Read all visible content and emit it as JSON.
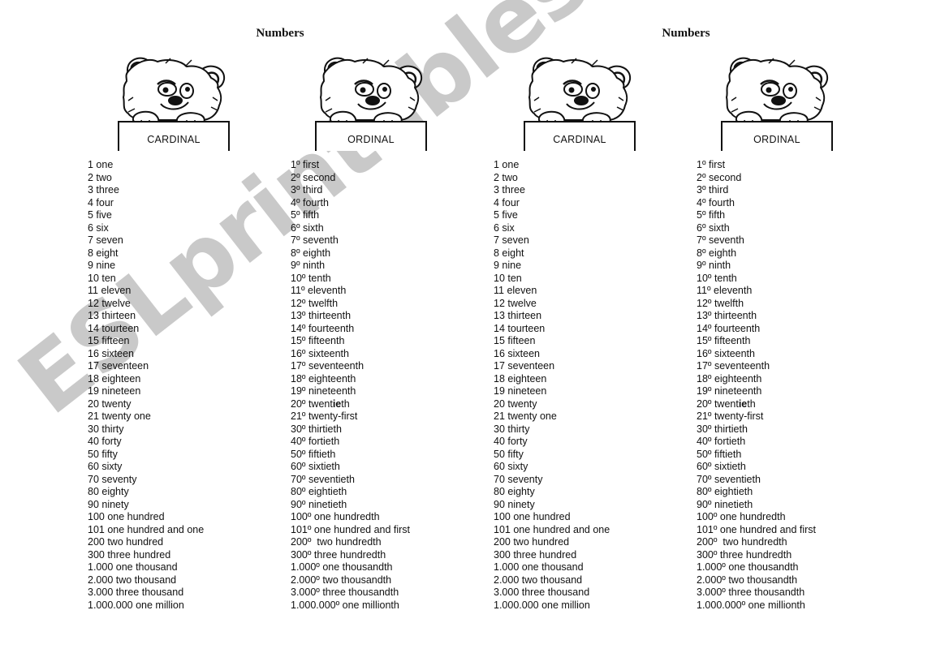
{
  "watermark": "ESLprintables.com",
  "colors": {
    "watermark": "#c9c9c9",
    "text": "#111111"
  },
  "pages": [
    {
      "title": "Numbers",
      "cardinal_label": "CARDINAL",
      "ordinal_label": "ORDINAL"
    },
    {
      "title": "Numbers",
      "cardinal_label": "CARDINAL",
      "ordinal_label": "ORDINAL"
    }
  ],
  "cardinal": [
    "1 one",
    "2 two",
    "3 three",
    "4 four",
    "5 five",
    "6 six",
    "7 seven",
    "8 eight",
    "9 nine",
    "10 ten",
    "11 eleven",
    "12 twelve",
    "13 thirteen",
    "14 tourteen",
    "15 fifteen",
    "16 sixteen",
    "17 seventeen",
    "18 eighteen",
    "19 nineteen",
    "20 twenty",
    "21 twenty one",
    "30 thirty",
    "40 forty",
    "50 fifty",
    "60 sixty",
    "70 seventy",
    "80 eighty",
    "90 ninety",
    "100 one hundred",
    "101 one hundred and one",
    "200 two hundred",
    "300 three hundred",
    "1.000 one thousand",
    "2.000 two thousand",
    "3.000 three thousand",
    "1.000.000 one million"
  ],
  "ordinal": [
    {
      "pre": "1º first"
    },
    {
      "pre": "2º second"
    },
    {
      "pre": "3º third"
    },
    {
      "pre": "4º fourth"
    },
    {
      "pre": "5º fifth"
    },
    {
      "pre": "6º sixth"
    },
    {
      "pre": "7º seventh"
    },
    {
      "pre": "8º eighth"
    },
    {
      "pre": "9º ninth"
    },
    {
      "pre": "10º tenth"
    },
    {
      "pre": "11º eleventh"
    },
    {
      "pre": "12º twelfth"
    },
    {
      "pre": "13º thirteenth"
    },
    {
      "pre": "14º fourteenth"
    },
    {
      "pre": "15º fifteenth"
    },
    {
      "pre": "16º sixteenth"
    },
    {
      "pre": "17º seventeenth"
    },
    {
      "pre": "18º eighteenth"
    },
    {
      "pre": "19º nineteenth"
    },
    {
      "pre": "20º twent",
      "bold": "ie",
      "post": "th"
    },
    {
      "pre": "21º twenty-first"
    },
    {
      "pre": "30º thirtieth"
    },
    {
      "pre": "40º fortieth"
    },
    {
      "pre": "50º fiftieth"
    },
    {
      "pre": "60º sixtieth"
    },
    {
      "pre": "70º seventieth"
    },
    {
      "pre": "80º eightieth"
    },
    {
      "pre": "90º ninetieth"
    },
    {
      "pre": "100º one hundredth"
    },
    {
      "pre": "101º one hundred and first"
    },
    {
      "pre": "200º  two hundredth"
    },
    {
      "pre": "300º three hundredth"
    },
    {
      "pre": "1.000º one thousandth"
    },
    {
      "pre": "2.000º two thousandth"
    },
    {
      "pre": "3.000º three thousandth"
    },
    {
      "pre": "1.000.000º one millionth"
    }
  ]
}
